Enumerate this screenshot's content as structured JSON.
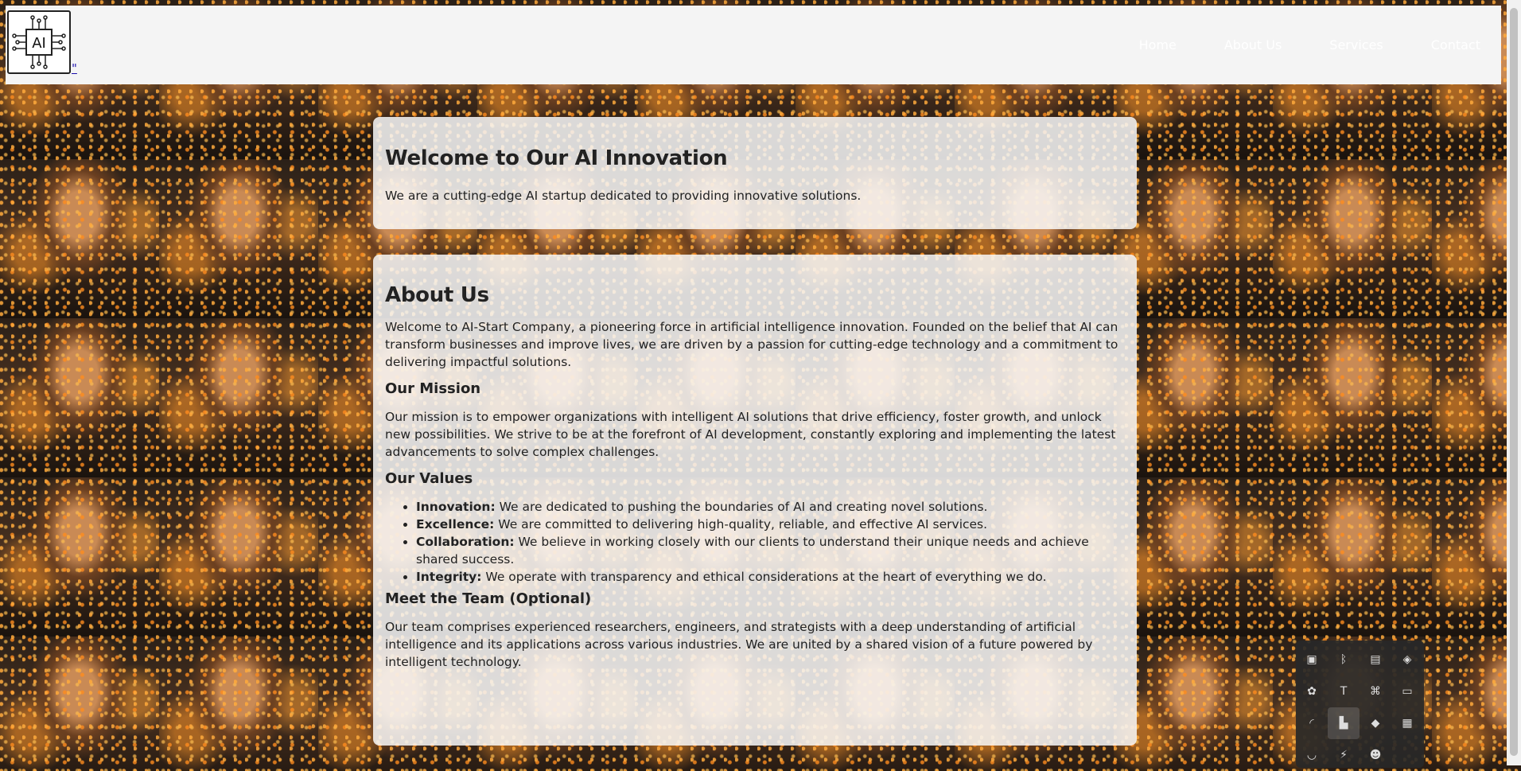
{
  "header": {
    "logo_text": "AI",
    "logo_quote": "\"",
    "nav": [
      "Home",
      "About Us",
      "Services",
      "Contact"
    ]
  },
  "welcome": {
    "title": "Welcome to Our AI Innovation",
    "text": "We are a cutting-edge AI startup dedicated to providing innovative solutions."
  },
  "about": {
    "title": "About Us",
    "intro": "Welcome to AI-Start Company, a pioneering force in artificial intelligence innovation. Founded on the belief that AI can transform businesses and improve lives, we are driven by a passion for cutting-edge technology and a commitment to delivering impactful solutions.",
    "mission_title": "Our Mission",
    "mission_text": "Our mission is to empower organizations with intelligent AI solutions that drive efficiency, foster growth, and unlock new possibilities. We strive to be at the forefront of AI development, constantly exploring and implementing the latest advancements to solve complex challenges.",
    "values_title": "Our Values",
    "values": [
      {
        "name": "Innovation:",
        "text": " We are dedicated to pushing the boundaries of AI and creating novel solutions."
      },
      {
        "name": "Excellence:",
        "text": " We are committed to delivering high-quality, reliable, and effective AI services."
      },
      {
        "name": "Collaboration:",
        "text": " We believe in working closely with our clients to understand their unique needs and achieve shared success."
      },
      {
        "name": "Integrity:",
        "text": " We operate with transparency and ethical considerations at the heart of everything we do."
      }
    ],
    "team_title": "Meet the Team (Optional)",
    "team_text": "Our team comprises experienced researchers, engineers, and strategists with a deep understanding of artificial intelligence and its applications across various industries. We are united by a shared vision of a future powered by intelligent technology."
  },
  "tray": {
    "icons": [
      "display-icon",
      "bluetooth-icon",
      "network-manager-icon",
      "security-shield-icon",
      "app-icon",
      "teams-icon",
      "tool-icon",
      "battery-icon",
      "wifi-icon",
      "bookmark-icon",
      "stack-icon",
      "photo-icon",
      "cup-icon",
      "lightning-icon",
      "discord-icon"
    ],
    "glyphs": [
      "▣",
      "ᛒ",
      "▤",
      "◈",
      "✿",
      "T",
      "⌘",
      "▭",
      "◜",
      "▙",
      "◆",
      "▦",
      "◡",
      "⚡",
      "☻"
    ],
    "colors": {
      "accent": "#3b82f6"
    }
  }
}
